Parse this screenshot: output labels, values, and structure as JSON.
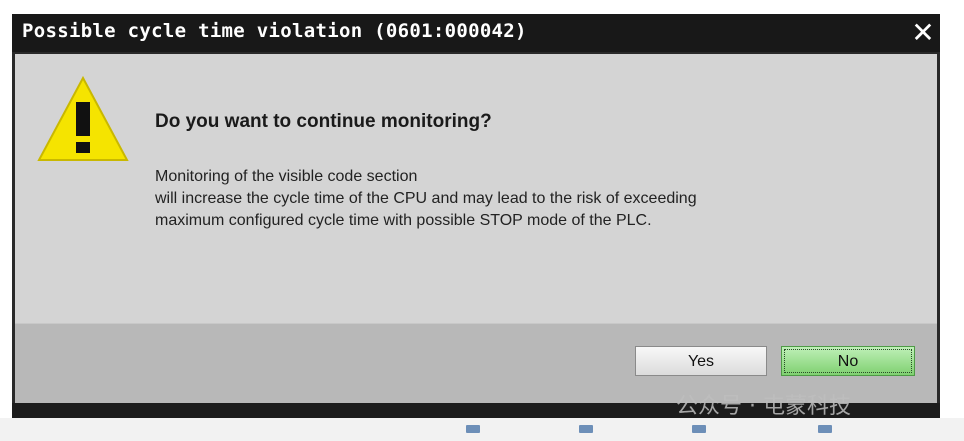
{
  "dialog": {
    "title": "Possible cycle time violation (0601:000042)",
    "close_glyph": "✕",
    "icon": "warning-icon",
    "question": "Do you want to continue monitoring?",
    "message_lines": [
      "Monitoring of the visible code section",
      "will increase the cycle time of the CPU and may lead to the risk of exceeding",
      "maximum configured cycle time with possible STOP mode of the PLC."
    ],
    "buttons": {
      "yes": "Yes",
      "no": "No"
    },
    "colors": {
      "title_bar": "#181818",
      "content_bg": "#d4d4d4",
      "footer_bg": "#b8b8b8",
      "warning_yellow": "#f5e400",
      "no_button": "#8fdc80"
    }
  },
  "watermark": "公众号 · 屯蒙科技"
}
